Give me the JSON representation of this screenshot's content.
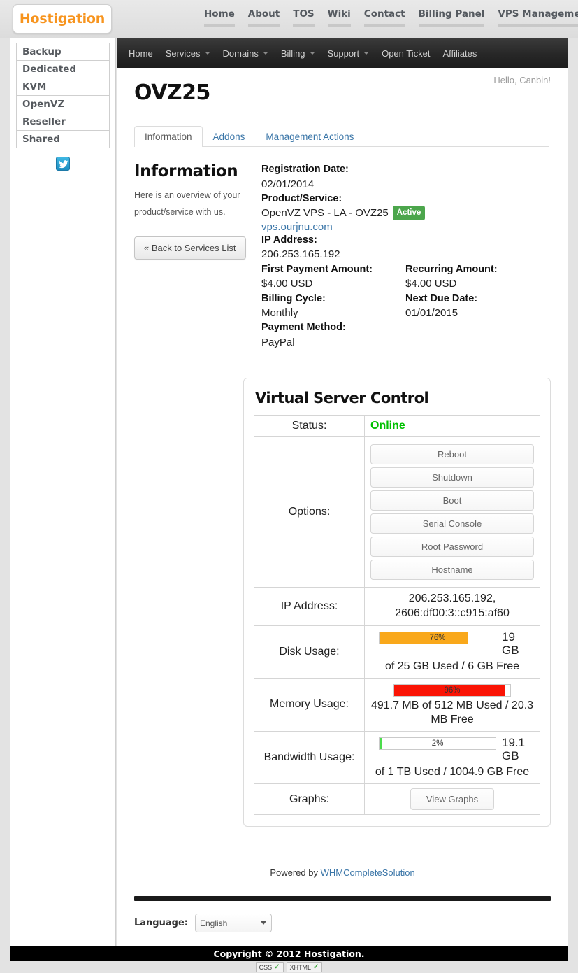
{
  "brand": {
    "logo_text": "Hostigation",
    "logo_color": "#f7941e"
  },
  "topnav": [
    {
      "label": "Home"
    },
    {
      "label": "About"
    },
    {
      "label": "TOS"
    },
    {
      "label": "Wiki"
    },
    {
      "label": "Contact"
    },
    {
      "label": "Billing Panel"
    },
    {
      "label": "VPS Management"
    }
  ],
  "sidebar": {
    "items": [
      {
        "label": "Backup"
      },
      {
        "label": "Dedicated"
      },
      {
        "label": "KVM"
      },
      {
        "label": "OpenVZ"
      },
      {
        "label": "Reseller"
      },
      {
        "label": "Shared"
      }
    ],
    "social_icon": "twitter-icon"
  },
  "darknav": [
    {
      "label": "Home",
      "caret": false
    },
    {
      "label": "Services",
      "caret": true
    },
    {
      "label": "Domains",
      "caret": true
    },
    {
      "label": "Billing",
      "caret": true
    },
    {
      "label": "Support",
      "caret": true
    },
    {
      "label": "Open Ticket",
      "caret": false
    },
    {
      "label": "Affiliates",
      "caret": false
    }
  ],
  "header": {
    "title": "OVZ25",
    "greeting": "Hello, Canbin!"
  },
  "tabs": [
    {
      "label": "Information",
      "active": true
    },
    {
      "label": "Addons",
      "active": false
    },
    {
      "label": "Management Actions",
      "active": false
    }
  ],
  "information": {
    "heading": "Information",
    "description": "Here is an overview of your product/service with us.",
    "back_button": "« Back to Services List",
    "fields": {
      "registration_date_label": "Registration Date:",
      "registration_date_value": "02/01/2014",
      "product_label": "Product/Service:",
      "product_value": "OpenVZ VPS - LA - OVZ25",
      "product_status_badge": "Active",
      "product_domain": "vps.ourjnu.com",
      "ip_label": "IP Address:",
      "ip_value": "206.253.165.192",
      "first_payment_label": "First Payment Amount:",
      "first_payment_value": "$4.00 USD",
      "recurring_label": "Recurring Amount:",
      "recurring_value": "$4.00 USD",
      "billing_cycle_label": "Billing Cycle:",
      "billing_cycle_value": "Monthly",
      "next_due_label": "Next Due Date:",
      "next_due_value": "01/01/2015",
      "payment_method_label": "Payment Method:",
      "payment_method_value": "PayPal"
    }
  },
  "vsc": {
    "title": "Virtual Server Control",
    "status_label": "Status:",
    "status_value": "Online",
    "status_color": "#00c000",
    "options_label": "Options:",
    "options": [
      {
        "label": "Reboot"
      },
      {
        "label": "Shutdown"
      },
      {
        "label": "Boot"
      },
      {
        "label": "Serial Console"
      },
      {
        "label": "Root Password"
      },
      {
        "label": "Hostname"
      }
    ],
    "ip_label": "IP Address:",
    "ip_value": "206.253.165.192, 2606:df00:3::c915:af60",
    "disk_label": "Disk Usage:",
    "disk_pct": "76%",
    "disk_pct_num": 76,
    "disk_color": "#f9a81b",
    "disk_side": "19 GB",
    "disk_text": "of 25 GB Used / 6 GB Free",
    "memory_label": "Memory Usage:",
    "memory_pct": "96%",
    "memory_pct_num": 96,
    "memory_color": "#fa1405",
    "memory_text": "491.7 MB of 512 MB Used / 20.3 MB Free",
    "bandwidth_label": "Bandwidth Usage:",
    "bandwidth_pct": "2%",
    "bandwidth_pct_num": 2,
    "bandwidth_color": "#4cdd4c",
    "bandwidth_side": "19.1 GB",
    "bandwidth_text": "of 1 TB Used / 1004.9 GB Free",
    "graphs_label": "Graphs:",
    "graphs_button": "View Graphs"
  },
  "footer": {
    "powered_prefix": "Powered by ",
    "powered_link": "WHMCompleteSolution",
    "language_label": "Language:",
    "language_value": "English",
    "copyright": "Copyright © 2012 Hostigation.",
    "validators": [
      {
        "label": "CSS"
      },
      {
        "label": "XHTML"
      }
    ]
  }
}
